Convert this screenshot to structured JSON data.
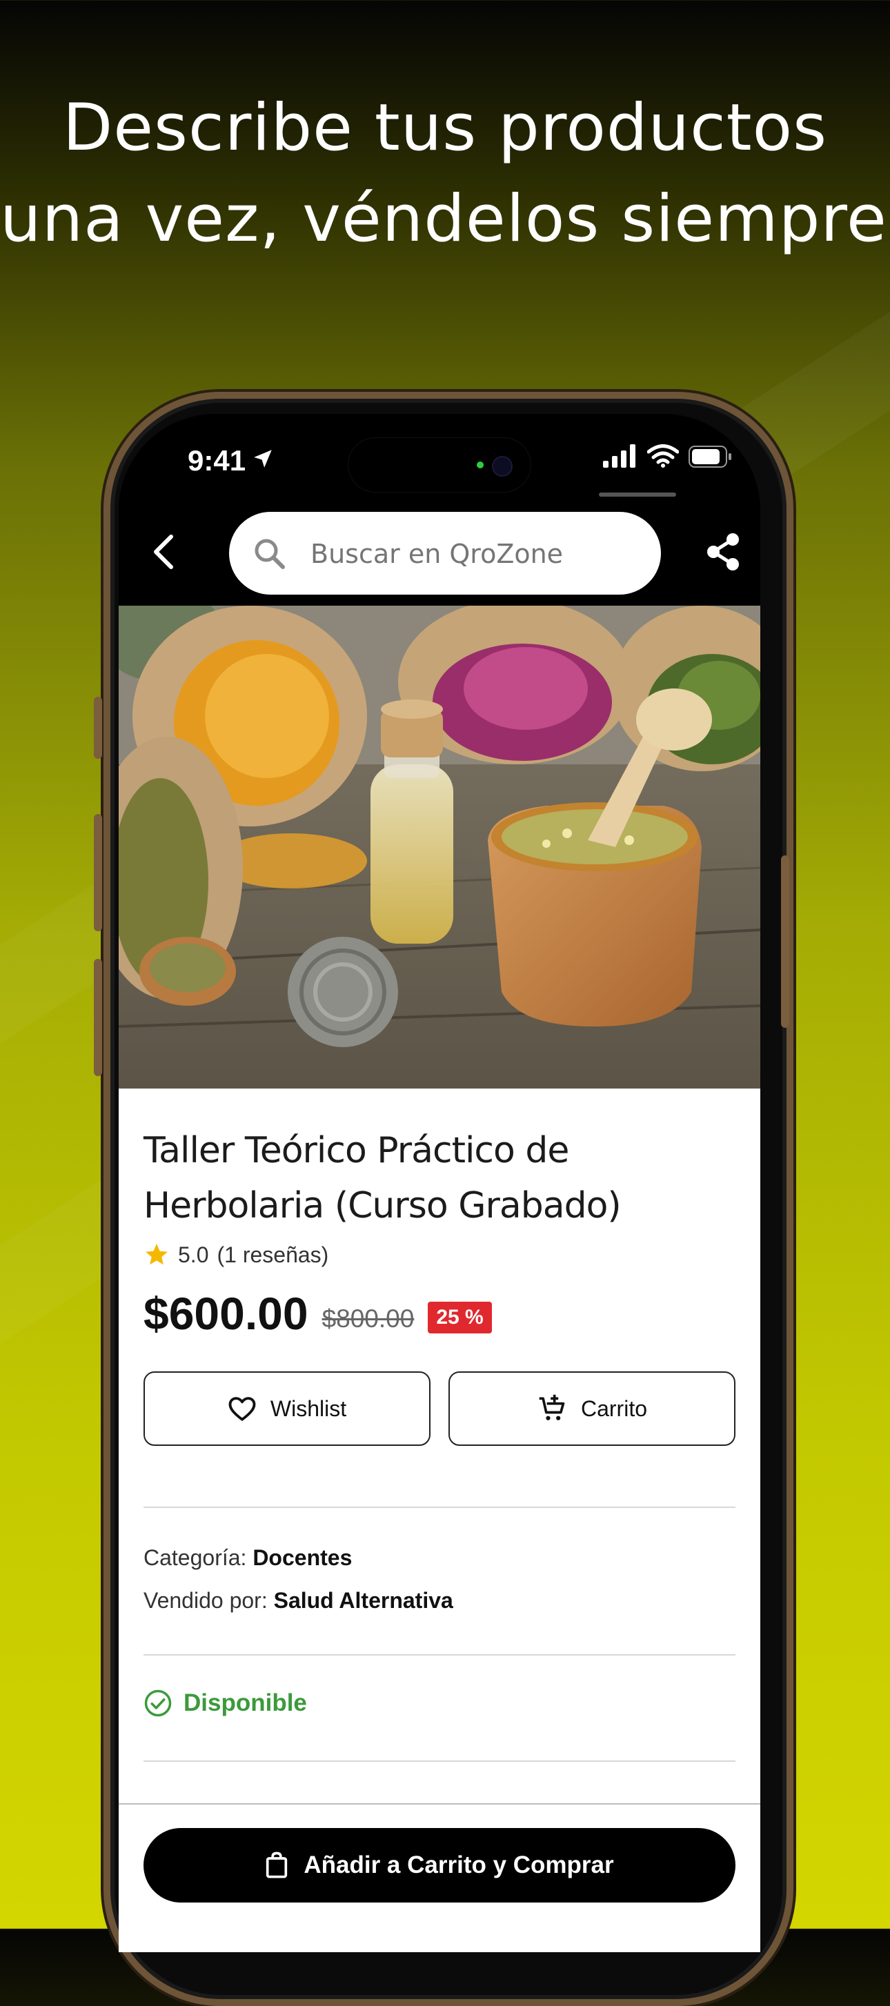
{
  "headline": {
    "line1": "Describe tus productos",
    "line2": "una vez, véndelos siempre."
  },
  "status_bar": {
    "time": "9:41"
  },
  "search": {
    "placeholder": "Buscar en QroZone"
  },
  "product": {
    "title": "Taller Teórico Práctico de Herbolaria (Curso Grabado)",
    "rating": "5.0",
    "reviews": "(1 reseñas)",
    "price": "$600.00",
    "old_price": "$800.00",
    "discount": "25 %",
    "category_label": "Categoría:",
    "category_value": "Docentes",
    "seller_label": "Vendido por:",
    "seller_value": "Salud Alternativa",
    "availability": "Disponible"
  },
  "buttons": {
    "wishlist": "Wishlist",
    "cart": "Carrito",
    "buy": "Añadir a Carrito y Comprar"
  },
  "colors": {
    "discount_badge": "#e0282f",
    "available": "#3b9a3b",
    "star": "#f5b800"
  },
  "icons": [
    "back-icon",
    "search-icon",
    "share-icon",
    "star-icon",
    "heart-icon",
    "cart-add-icon",
    "check-circle-icon",
    "shopping-bag-icon"
  ]
}
